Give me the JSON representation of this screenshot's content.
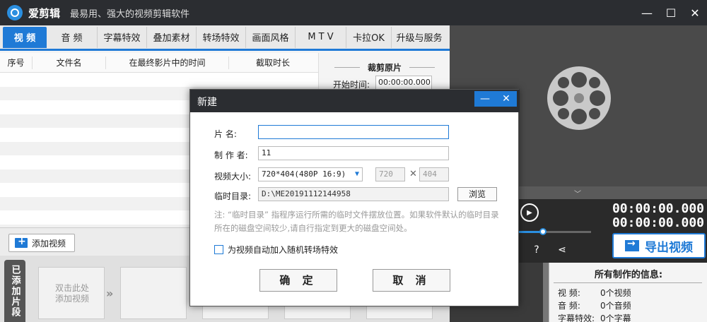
{
  "app": {
    "name": "爱剪辑",
    "slogan": "最易用、强大的视频剪辑软件",
    "window_controls": {
      "minimize": "—",
      "restore": "☐",
      "close": "✕"
    }
  },
  "tabs": [
    {
      "label": "视 频"
    },
    {
      "label": "音 频"
    },
    {
      "label": "字幕特效"
    },
    {
      "label": "叠加素材"
    },
    {
      "label": "转场特效"
    },
    {
      "label": "画面风格"
    },
    {
      "label": "M T V"
    },
    {
      "label": "卡拉OK"
    },
    {
      "label": "升级与服务"
    }
  ],
  "table": {
    "headers": [
      "序号",
      "文件名",
      "在最终影片中的时间",
      "截取时长"
    ]
  },
  "crop": {
    "title": "裁剪原片",
    "start_label": "开始时间:",
    "start_value": "00:00:00.000"
  },
  "add_video_label": "添加视频",
  "strip": {
    "label": "已添加片段",
    "hint_line1": "双击此处",
    "hint_line2": "添加视频"
  },
  "player": {
    "time_current": "00:00:00.000",
    "time_total": "00:00:00.000",
    "volume_level": 0.6
  },
  "export_label": "导出视频",
  "info": {
    "title": "所有制作的信息:",
    "rows": [
      {
        "key": "视    频:",
        "value": "0个视频"
      },
      {
        "key": "音    频:",
        "value": "0个音频"
      },
      {
        "key": "字幕特效:",
        "value": "0个字幕"
      }
    ]
  },
  "dialog": {
    "title": "新建",
    "min": "—",
    "close": "✕",
    "name_label": "片    名:",
    "name_value": "",
    "author_label": "制 作 者:",
    "author_value": "11",
    "size_label": "视频大小:",
    "size_value": "720*404(480P 16:9)",
    "width_value": "720",
    "height_value": "404",
    "times": "✕",
    "tmp_label": "临时目录:",
    "tmp_value": "D:\\ME20191112144958",
    "browse_label": "浏览",
    "note": "注: “临时目录” 指程序运行所需的临时文件摆放位置。如果软件默认的临时目录所在的磁盘空间较少,请自行指定到更大的磁盘空间处。",
    "checkbox_label": "为视频自动加入随机转场特效",
    "ok_label": "确 定",
    "cancel_label": "取 消"
  },
  "colors": {
    "accent": "#1f7ad6",
    "titlebar": "#2b2d31"
  }
}
